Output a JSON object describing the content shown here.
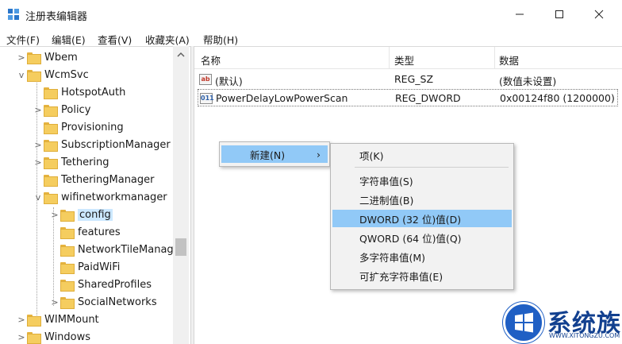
{
  "window": {
    "title": "注册表编辑器"
  },
  "menu": [
    "文件(F)",
    "编辑(E)",
    "查看(V)",
    "收藏夹(A)",
    "帮助(H)"
  ],
  "tree": {
    "items": [
      {
        "label": "Wbem",
        "expander": ">"
      },
      {
        "label": "WcmSvc",
        "expander": "v"
      },
      {
        "label": "HotspotAuth",
        "expander": ""
      },
      {
        "label": "Policy",
        "expander": ">"
      },
      {
        "label": "Provisioning",
        "expander": ""
      },
      {
        "label": "SubscriptionManager",
        "expander": ">"
      },
      {
        "label": "Tethering",
        "expander": ">"
      },
      {
        "label": "TetheringManager",
        "expander": ""
      },
      {
        "label": "wifinetworkmanager",
        "expander": "v"
      },
      {
        "label": "config",
        "expander": ">",
        "selected": true
      },
      {
        "label": "features",
        "expander": ""
      },
      {
        "label": "NetworkTileManager",
        "expander": ""
      },
      {
        "label": "PaidWiFi",
        "expander": ""
      },
      {
        "label": "SharedProfiles",
        "expander": ""
      },
      {
        "label": "SocialNetworks",
        "expander": ">"
      },
      {
        "label": "WIMMount",
        "expander": ">"
      },
      {
        "label": "Windows",
        "expander": ">"
      }
    ]
  },
  "list": {
    "columns": {
      "name": "名称",
      "type": "类型",
      "data": "数据"
    },
    "rows": [
      {
        "icon_text": "ab",
        "name": "(默认)",
        "type": "REG_SZ",
        "data": "(数值未设置)"
      },
      {
        "icon_text": "011",
        "name": "PowerDelayLowPowerScan",
        "type": "REG_DWORD",
        "data": "0x00124f80 (1200000)"
      }
    ]
  },
  "context_menu": {
    "new_label": "新建(N)",
    "arrow": "›"
  },
  "submenu": {
    "items": [
      "项(K)",
      "字符串值(S)",
      "二进制值(B)",
      "DWORD (32 位)值(D)",
      "QWORD (64 位)值(Q)",
      "多字符串值(M)",
      "可扩充字符串值(E)"
    ]
  },
  "watermark": {
    "text": "系统族",
    "sub": "WWW.XITONGZU.COM"
  },
  "colors": {
    "highlight": "#91c9f7",
    "selection": "#cce8ff",
    "folder": "#f5cd5f",
    "watermark": "#12408f"
  }
}
